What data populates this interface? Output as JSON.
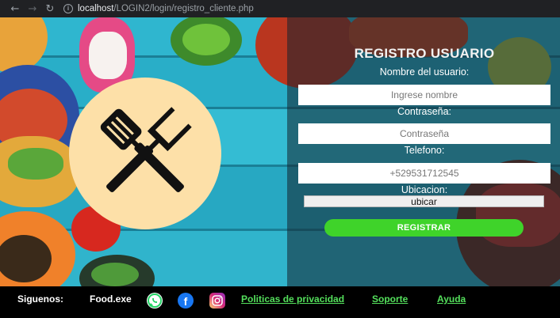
{
  "browser": {
    "back_icon": "arrow-left-icon",
    "forward_icon": "arrow-right-icon",
    "reload_icon": "reload-icon",
    "url_host": "localhost",
    "url_path": "/LOGIN2/login/registro_cliente.php"
  },
  "form": {
    "title": "REGISTRO USUARIO",
    "username_label": "Nombre del usuario:",
    "username_placeholder": "Ingrese nombre",
    "password_label": "Contraseña:",
    "password_placeholder": "Contraseña",
    "phone_label": "Telefono:",
    "phone_placeholder": "+529531712545",
    "location_label": "Ubicacion:",
    "locate_button": "ubicar",
    "submit_button": "REGISTRAR"
  },
  "footer": {
    "follow_label": "Siguenos:",
    "brand": "Food.exe",
    "links": {
      "privacy": "Politicas de privacidad",
      "support": "Soporte",
      "help": "Ayuda"
    }
  },
  "colors": {
    "accent_green": "#3fd32a",
    "link_green": "#54e05c",
    "logo_bg": "#fde0a8",
    "wood_turquoise": "#26a9c4"
  }
}
